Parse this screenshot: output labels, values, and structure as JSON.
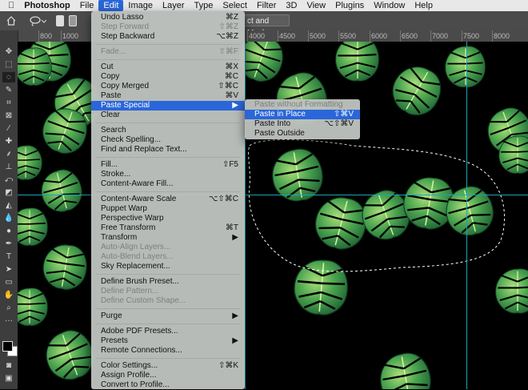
{
  "menubar": {
    "apple": "",
    "app": "Photoshop",
    "items": [
      "File",
      "Edit",
      "Image",
      "Layer",
      "Type",
      "Select",
      "Filter",
      "3D",
      "View",
      "Plugins",
      "Window",
      "Help"
    ]
  },
  "options": {
    "select_mask": "ct and Mask..."
  },
  "ruler": {
    "ticks": [
      "800",
      "1000",
      "4000",
      "4500",
      "5000",
      "5500",
      "6000",
      "6500",
      "7000",
      "7500",
      "8000"
    ]
  },
  "edit_menu": {
    "undo": {
      "label": "Undo Lasso",
      "sc": "⌘Z"
    },
    "step_forward": {
      "label": "Step Forward",
      "sc": "⇧⌘Z"
    },
    "step_backward": {
      "label": "Step Backward",
      "sc": "⌥⌘Z"
    },
    "fade": {
      "label": "Fade...",
      "sc": "⇧⌘F"
    },
    "cut": {
      "label": "Cut",
      "sc": "⌘X"
    },
    "copy": {
      "label": "Copy",
      "sc": "⌘C"
    },
    "copy_merged": {
      "label": "Copy Merged",
      "sc": "⇧⌘C"
    },
    "paste": {
      "label": "Paste",
      "sc": "⌘V"
    },
    "paste_special": {
      "label": "Paste Special",
      "sc": "▶"
    },
    "clear": {
      "label": "Clear"
    },
    "search": {
      "label": "Search"
    },
    "check_spelling": {
      "label": "Check Spelling..."
    },
    "find_replace": {
      "label": "Find and Replace Text..."
    },
    "fill": {
      "label": "Fill...",
      "sc": "⇧F5"
    },
    "stroke": {
      "label": "Stroke..."
    },
    "caf": {
      "label": "Content-Aware Fill..."
    },
    "cas": {
      "label": "Content-Aware Scale",
      "sc": "⌥⇧⌘C"
    },
    "puppet": {
      "label": "Puppet Warp"
    },
    "perspective": {
      "label": "Perspective Warp"
    },
    "free_transform": {
      "label": "Free Transform",
      "sc": "⌘T"
    },
    "transform": {
      "label": "Transform",
      "sc": "▶"
    },
    "auto_align": {
      "label": "Auto-Align Layers..."
    },
    "auto_blend": {
      "label": "Auto-Blend Layers..."
    },
    "sky": {
      "label": "Sky Replacement..."
    },
    "brush_preset": {
      "label": "Define Brush Preset..."
    },
    "pattern": {
      "label": "Define Pattern..."
    },
    "custom_shape": {
      "label": "Define Custom Shape..."
    },
    "purge": {
      "label": "Purge",
      "sc": "▶"
    },
    "pdf_presets": {
      "label": "Adobe PDF Presets..."
    },
    "presets": {
      "label": "Presets",
      "sc": "▶"
    },
    "remote": {
      "label": "Remote Connections..."
    },
    "color_settings": {
      "label": "Color Settings...",
      "sc": "⇧⌘K"
    },
    "assign_profile": {
      "label": "Assign Profile..."
    },
    "convert_profile": {
      "label": "Convert to Profile..."
    }
  },
  "paste_special_menu": {
    "no_format": {
      "label": "Paste without Formatting"
    },
    "in_place": {
      "label": "Paste in Place",
      "sc": "⇧⌘V"
    },
    "into": {
      "label": "Paste Into",
      "sc": "⌥⇧⌘V"
    },
    "outside": {
      "label": "Paste Outside"
    }
  },
  "colors": {
    "menu_highlight": "#2a66d9",
    "guide": "#1fa3b3",
    "leaf_dark": "#1e6b2e",
    "leaf_light": "#7fcf5a"
  }
}
